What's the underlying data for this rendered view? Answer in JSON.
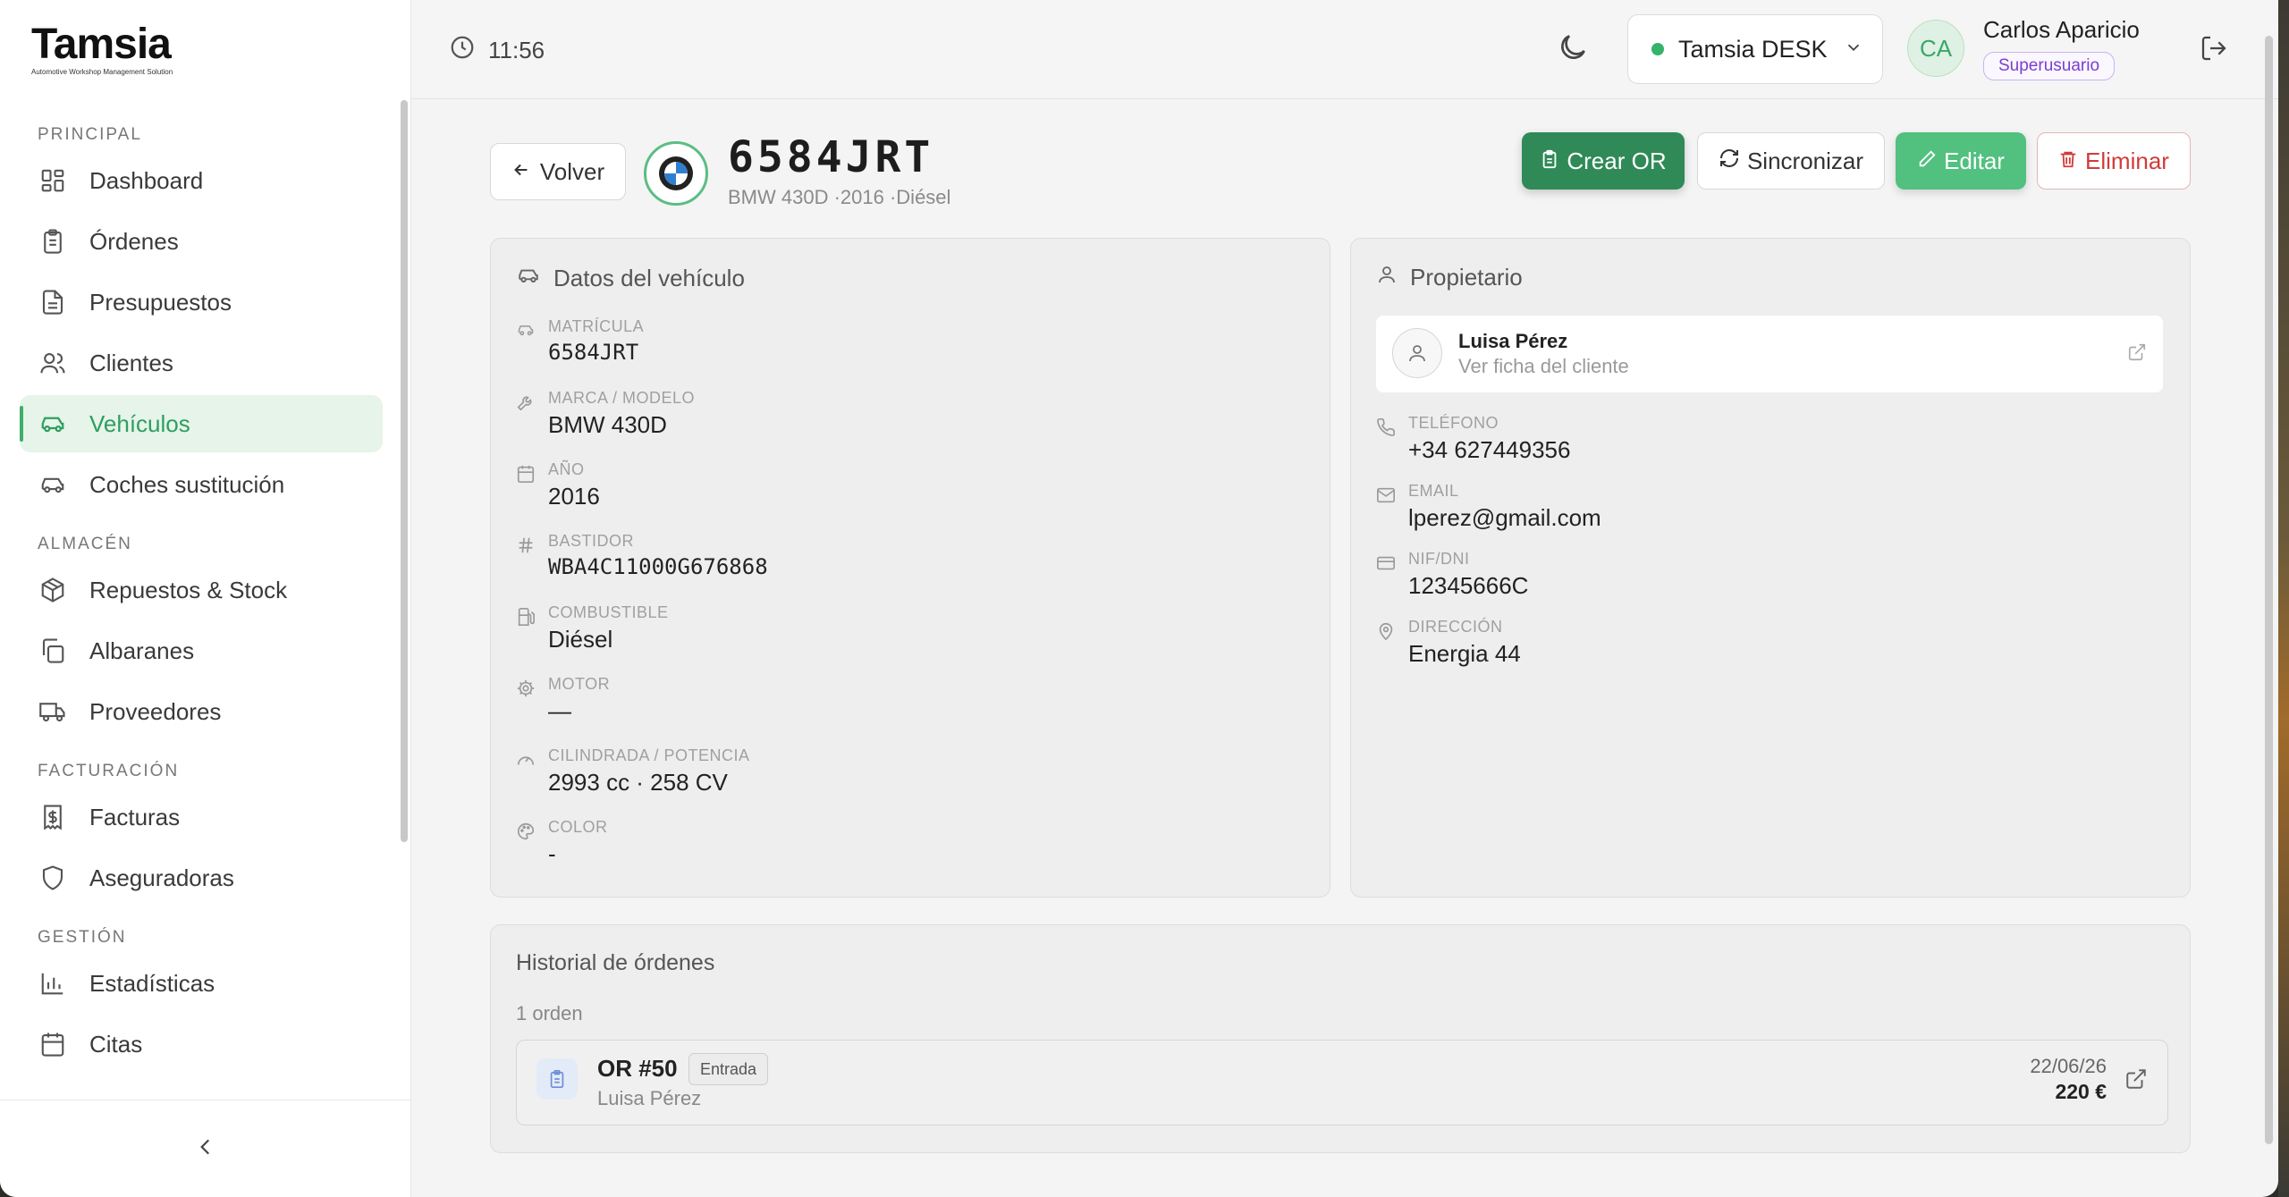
{
  "brand": {
    "name": "Tamsia",
    "tagline": "Automotive Workshop Management Solution"
  },
  "sidebar": {
    "sections": [
      {
        "title": "PRINCIPAL",
        "items": [
          {
            "label": "Dashboard",
            "icon": "dashboard-icon"
          },
          {
            "label": "Órdenes",
            "icon": "clipboard-icon"
          },
          {
            "label": "Presupuestos",
            "icon": "document-icon"
          },
          {
            "label": "Clientes",
            "icon": "users-icon"
          },
          {
            "label": "Vehículos",
            "icon": "car-icon",
            "active": true
          },
          {
            "label": "Coches sustitución",
            "icon": "car-icon"
          }
        ]
      },
      {
        "title": "ALMACÉN",
        "items": [
          {
            "label": "Repuestos & Stock",
            "icon": "package-icon"
          },
          {
            "label": "Albaranes",
            "icon": "copy-icon"
          },
          {
            "label": "Proveedores",
            "icon": "truck-icon"
          }
        ]
      },
      {
        "title": "FACTURACIÓN",
        "items": [
          {
            "label": "Facturas",
            "icon": "invoice-dollar-icon"
          },
          {
            "label": "Aseguradoras",
            "icon": "shield-icon"
          }
        ]
      },
      {
        "title": "GESTIÓN",
        "items": [
          {
            "label": "Estadísticas",
            "icon": "bar-chart-icon"
          },
          {
            "label": "Citas",
            "icon": "calendar-icon"
          }
        ]
      }
    ]
  },
  "header": {
    "time": "11:56",
    "workspace": "Tamsia DESK",
    "user_initials": "CA",
    "user_name": "Carlos Aparicio",
    "user_role": "Superusuario"
  },
  "vehicle": {
    "back_label": "Volver",
    "plate": "6584JRT",
    "subtitle": "BMW 430D  ·2016  ·Diésel",
    "actions": {
      "create": "Crear OR",
      "sync": "Sincronizar",
      "edit": "Editar",
      "delete": "Eliminar"
    }
  },
  "vehicle_data": {
    "title": "Datos del vehículo",
    "fields": [
      {
        "label": "MATRÍCULA",
        "value": "6584JRT"
      },
      {
        "label": "MARCA / MODELO",
        "value": "BMW 430D"
      },
      {
        "label": "AÑO",
        "value": "2016"
      },
      {
        "label": "BASTIDOR",
        "value": "WBA4C11000G676868"
      },
      {
        "label": "COMBUSTIBLE",
        "value": "Diésel"
      },
      {
        "label": "MOTOR",
        "value": "—"
      },
      {
        "label": "CILINDRADA / POTENCIA",
        "value": "2993 cc · 258 CV"
      },
      {
        "label": "COLOR",
        "value": "-"
      }
    ]
  },
  "owner": {
    "title": "Propietario",
    "name": "Luisa Pérez",
    "link": "Ver ficha del cliente",
    "fields": [
      {
        "label": "TELÉFONO",
        "value": "+34 627449356"
      },
      {
        "label": "EMAIL",
        "value": "lperez@gmail.com"
      },
      {
        "label": "NIF/DNI",
        "value": "12345666C"
      },
      {
        "label": "DIRECCIÓN",
        "value": "Energia 44"
      }
    ]
  },
  "history": {
    "title": "Historial de órdenes",
    "count": "1 orden",
    "orders": [
      {
        "number": "OR #50",
        "status": "Entrada",
        "client": "Luisa Pérez",
        "date": "22/06/26",
        "amount": "220 €"
      }
    ]
  },
  "colors": {
    "accent": "#2f9e5e",
    "primary_button": "#2f8a57",
    "edit_button": "#52c07f",
    "danger": "#d23a3a"
  }
}
